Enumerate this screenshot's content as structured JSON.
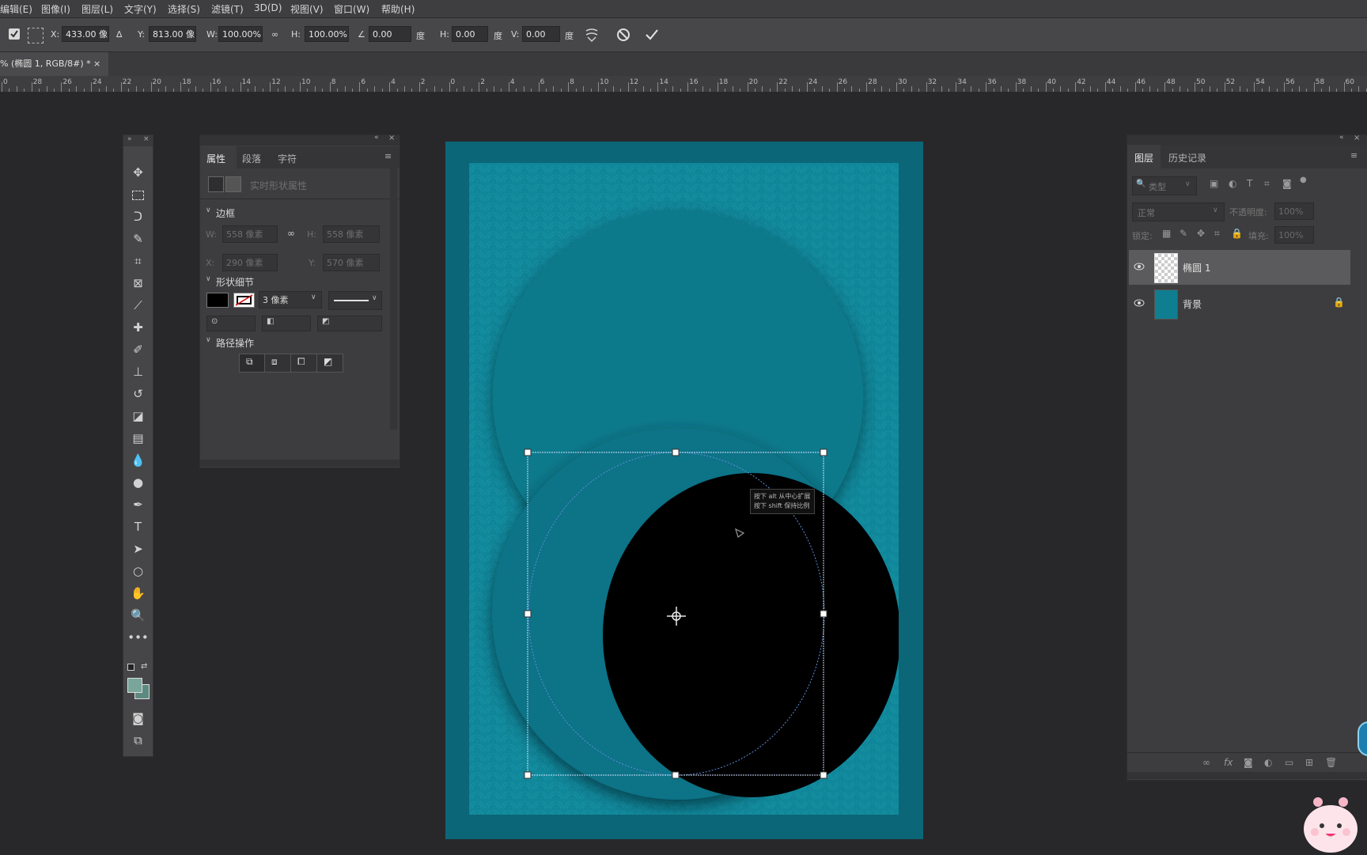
{
  "menu": [
    "编辑(E)",
    "图像(I)",
    "图层(L)",
    "文字(Y)",
    "选择(S)",
    "滤镜(T)",
    "3D(D)",
    "视图(V)",
    "窗口(W)",
    "帮助(H)"
  ],
  "options": {
    "x_label": "X:",
    "x_value": "433.00 像",
    "y_label": "Y:",
    "y_value": "813.00 像",
    "w_label": "W:",
    "w_value": "100.00%",
    "h_label": "H:",
    "h_value": "100.00%",
    "angle_value": "0.00",
    "angle_unit": "度",
    "hskew_label": "H:",
    "hskew_value": "0.00",
    "hskew_unit": "度",
    "vskew_label": "V:",
    "vskew_value": "0.00",
    "vskew_unit": "度"
  },
  "document_tab": {
    "title": "% (椭圆 1, RGB/8#) *",
    "close": "×"
  },
  "ruler_labels": [
    "0",
    "28",
    "26",
    "24",
    "22",
    "20",
    "18",
    "16",
    "14",
    "12",
    "10",
    "8",
    "6",
    "4",
    "2",
    "0",
    "2",
    "4",
    "6",
    "8",
    "10",
    "12",
    "14",
    "16",
    "18",
    "20",
    "22",
    "24",
    "26",
    "28",
    "30",
    "32",
    "34",
    "36",
    "38",
    "40",
    "42",
    "44",
    "46",
    "48",
    "50",
    "52",
    "54",
    "56",
    "58",
    "60"
  ],
  "properties": {
    "tabs": [
      "属性",
      "段落",
      "字符"
    ],
    "subtitle": "实时形状属性",
    "section_bounds": "边框",
    "w_label": "W:",
    "w_value": "558 像素",
    "h_label": "H:",
    "h_value": "558 像素",
    "x_label": "X:",
    "x_value": "290 像素",
    "y_label": "Y:",
    "y_value": "570 像素",
    "section_shape": "形状细节",
    "stroke_value": "3 像素",
    "section_path": "路径操作"
  },
  "canvas": {
    "tooltip_line1": "按下 alt 从中心扩展",
    "tooltip_line2": "按下 shift 保持比例"
  },
  "layers": {
    "tabs": [
      "图层",
      "历史记录"
    ],
    "filter_label": "类型",
    "blend_mode": "正常",
    "opacity_label": "不透明度:",
    "opacity_value": "100%",
    "lock_label": "锁定:",
    "fill_label": "填充:",
    "fill_value": "100%",
    "items": [
      {
        "name": "椭圆 1",
        "selected": true
      },
      {
        "name": "背景",
        "locked": true
      }
    ]
  },
  "colors": {
    "canvas_bg": "#10879a",
    "canvas_frame": "#0b6678",
    "ellipse_fill": "#000000",
    "selection_blue": "#5b8fd8"
  }
}
